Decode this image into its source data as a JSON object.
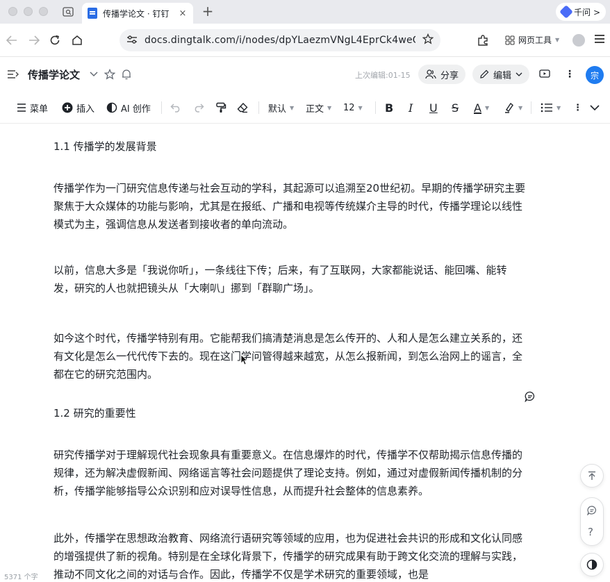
{
  "browser": {
    "tab": {
      "title": "传播学论文 · 钉钉",
      "close": "×"
    },
    "new_tab": "+",
    "qianwen_label": "千问 >",
    "url": "docs.dingtalk.com/i/nodes/dpYLaezmVNgL4EprCk4weGO...",
    "web_tools_label": "网页工具"
  },
  "doc": {
    "title": "传播学论文",
    "last_edit": "上次编辑:01-15",
    "share_label": "分享",
    "edit_label": "编辑",
    "user_initial": "宗"
  },
  "toolbar": {
    "menu_label": "菜单",
    "insert_label": "插入",
    "ai_label": "AI 创作",
    "font_family": "默认",
    "paragraph_style": "正文",
    "font_size": "12"
  },
  "content": {
    "heading_1": "1.1 传播学的发展背景",
    "para_1": "传播学作为一门研究信息传递与社会互动的学科，其起源可以追溯至20世纪初。早期的传播学研究主要聚焦于大众媒体的功能与影响，尤其是在报纸、广播和电视等传统媒介主导的时代，传播学理论以线性模式为主，强调信息从发送者到接收者的单向流动。",
    "para_2": "以前，信息大多是「我说你听」，一条线往下传；后来，有了互联网，大家都能说话、能回嘴、能转发，研究的人也就把镜头从「大喇叭」挪到「群聊广场」。",
    "para_3": "如今这个时代，传播学特别有用。它能帮我们搞清楚消息是怎么传开的、人和人是怎么建立关系的，还有文化是怎么一代代传下去的。现在这门学问管得越来越宽，从怎么报新闻，到怎么治网上的谣言，全都在它的研究范围内。",
    "heading_2": "1.2 研究的重要性",
    "para_4": "研究传播学对于理解现代社会现象具有重要意义。在信息爆炸的时代，传播学不仅帮助揭示信息传播的规律，还为解决虚假新闻、网络谣言等社会问题提供了理论支持。例如，通过对虚假新闻传播机制的分析，传播学能够指导公众识别和应对误导性信息，从而提升社会整体的信息素养。",
    "para_5": "此外，传播学在思想政治教育、网络流行语研究等领域的应用，也为促进社会共识的形成和文化认同感的增强提供了新的视角。特别是在全球化背景下，传播学的研究成果有助于跨文化交流的理解与实践，推动不同文化之间的对话与合作。因此，传播学不仅是学术研究的重要领域，也是"
  },
  "status": {
    "word_count": "5371 个字"
  },
  "float_buttons": {
    "help": "?"
  }
}
